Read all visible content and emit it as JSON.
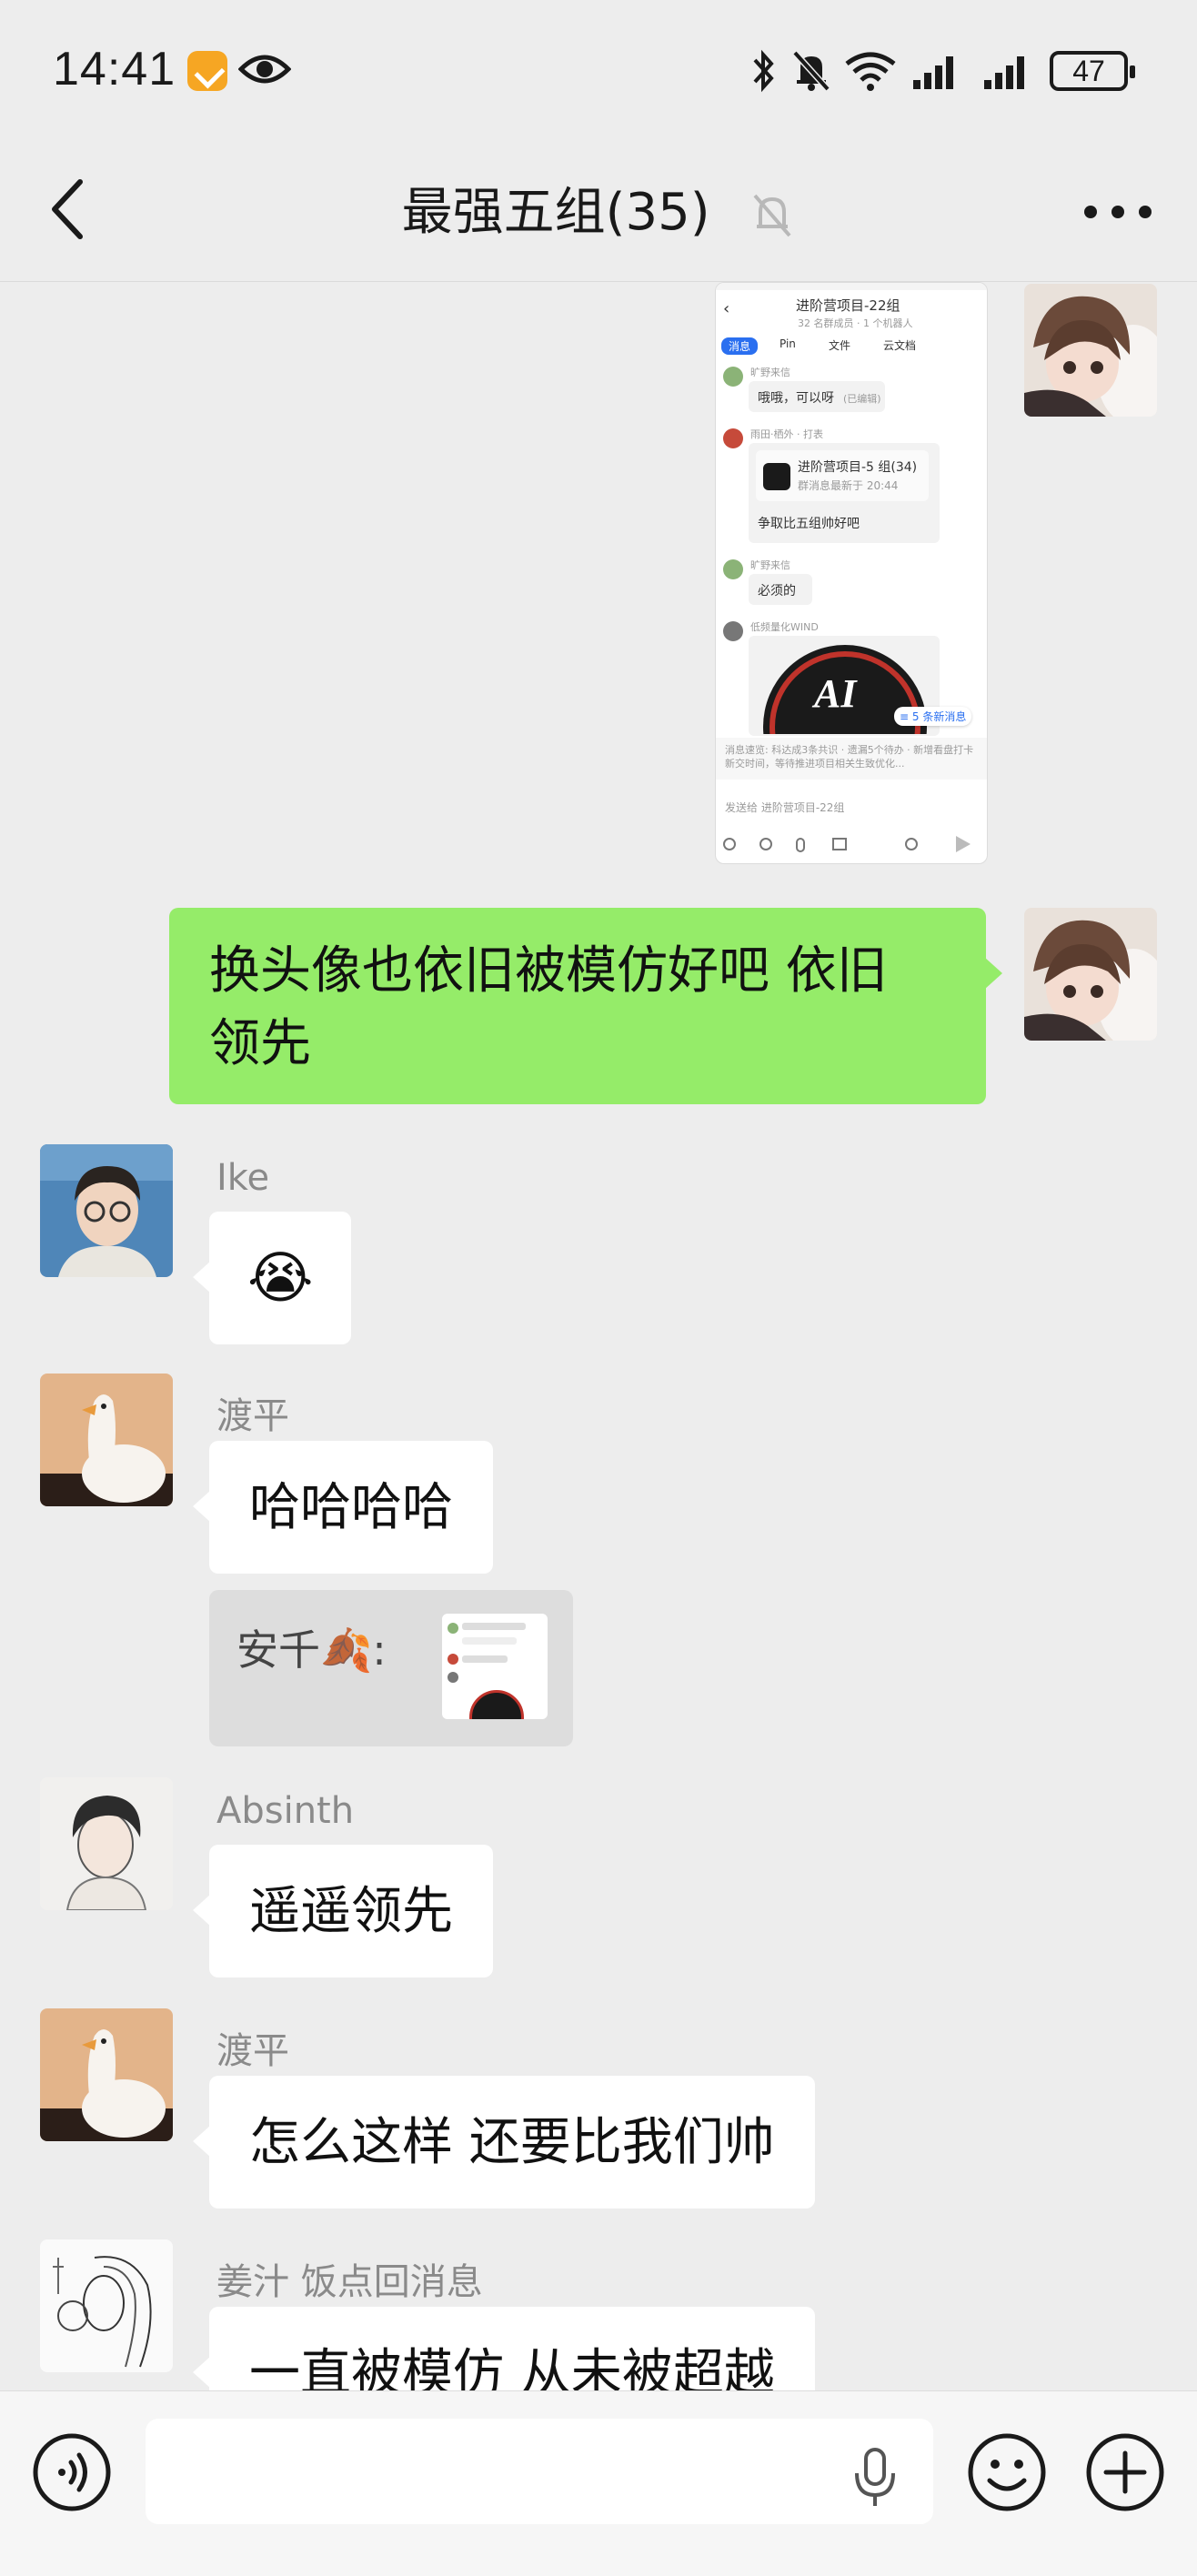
{
  "status_bar": {
    "time": "14:41",
    "battery": "47",
    "icons": [
      "app-badge-icon",
      "eye-icon",
      "bluetooth-icon",
      "mute-bell-icon",
      "wifi-icon",
      "signal-icon",
      "signal-icon",
      "battery-icon"
    ]
  },
  "nav": {
    "title": "最强五组(35)",
    "back_icon": "back-arrow-icon",
    "mute_icon": "bell-off-icon",
    "more_icon": "more-dots-icon"
  },
  "screenshot_message": {
    "header_title": "进阶营项目-22组",
    "header_sub": "32 名群成员 · 1 个机器人",
    "tabs": [
      "消息",
      "Pin",
      "文件",
      "云文档"
    ],
    "msgs": [
      {
        "name": "旷野来信",
        "text": "哦哦，可以呀",
        "edited": "(已编辑)"
      },
      {
        "name": "雨田·栖外 · 打表",
        "card_title": "进阶营项目-5 组(34)",
        "card_sub": "群消息最新于 20:44",
        "text": "争取比五组帅好吧"
      },
      {
        "name": "旷野来信",
        "text": "必须的"
      },
      {
        "name": "低频量化WIND",
        "badge": "≡ 5 条新消息"
      }
    ],
    "notice": "消息速览: 科达成3条共识 · 遗漏5个待办 · 新增看盘打卡新交时间，等待推进项目相关生致优化...",
    "input_placeholder": "发送给 进阶营项目-22组"
  },
  "messages": [
    {
      "side": "right",
      "text_line1": "换头像也依旧被模仿好吧 依旧",
      "text_line2": "领先"
    },
    {
      "side": "left",
      "sender": "Ike",
      "emoji": "😭"
    },
    {
      "side": "left",
      "sender": "渡平",
      "text": "哈哈哈哈"
    },
    {
      "quote_name": "安千",
      "quote_suffix": ":"
    },
    {
      "side": "left",
      "sender": "Absinth",
      "text": "遥遥领先"
    },
    {
      "side": "left",
      "sender": "渡平",
      "text": "怎么这样 还要比我们帅"
    },
    {
      "side": "left",
      "sender": "姜汁 饭点回消息",
      "text": "一直被模仿 从未被超越"
    }
  ],
  "input_bar": {
    "voice_icon": "voice-input-icon",
    "mic_icon": "microphone-icon",
    "emoji_icon": "emoji-icon",
    "plus_icon": "plus-icon"
  },
  "colors": {
    "background": "#ededed",
    "green_bubble": "#95ec69",
    "white_bubble": "#ffffff",
    "sender_gray": "#8a8a8a"
  }
}
